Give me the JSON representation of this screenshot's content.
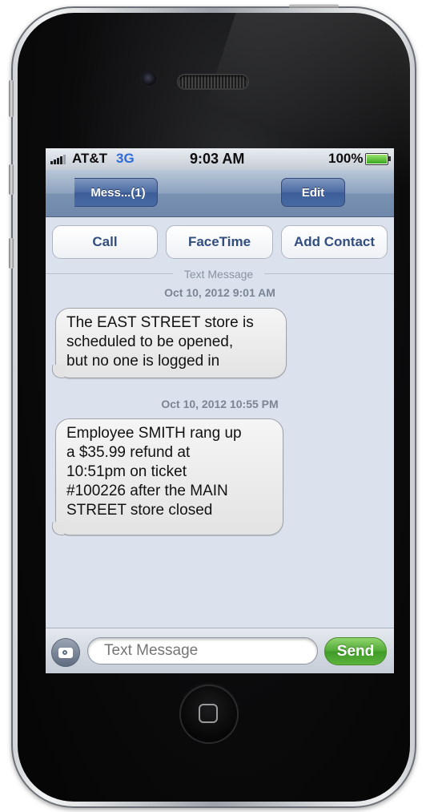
{
  "status_bar": {
    "carrier": "AT&T",
    "network": "3G",
    "time": "9:03 AM",
    "battery_percent": "100%",
    "battery_level": 1.0
  },
  "nav_bar": {
    "back_label": "Mess...(1)",
    "edit_label": "Edit"
  },
  "actions": {
    "call": "Call",
    "facetime": "FaceTime",
    "add_contact": "Add Contact"
  },
  "thread": {
    "divider_label": "Text Message",
    "messages": [
      {
        "timestamp": "Oct 10, 2012 9:01 AM",
        "text": "The EAST STREET store is\nscheduled to be opened,\nbut no one is logged in"
      },
      {
        "timestamp": "Oct 10, 2012 10:55 PM",
        "text": "Employee SMITH rang up\na $35.99 refund at\n10:51pm on ticket\n#100226 after the MAIN\nSTREET store closed"
      }
    ]
  },
  "compose": {
    "placeholder": "Text Message",
    "send_label": "Send"
  },
  "colors": {
    "screen_bg": "#dbe2ed",
    "nav_button": "#3c5d98",
    "network_blue": "#2e6bd7",
    "send_green": "#4fa834",
    "action_text": "#324e7f"
  },
  "icons": {
    "signal": "signal-bars-icon",
    "battery": "battery-icon",
    "camera": "camera-icon",
    "home": "home-square-icon"
  }
}
